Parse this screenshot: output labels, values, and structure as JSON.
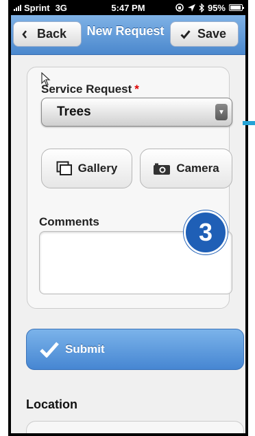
{
  "status_bar": {
    "carrier": "Sprint",
    "network": "3G",
    "time": "5:47 PM",
    "battery": "95%"
  },
  "header": {
    "back_label": "Back",
    "title": "New Request",
    "save_label": "Save"
  },
  "form": {
    "service_label": "Service Request",
    "required_marker": "*",
    "service_value": "Trees",
    "gallery_label": "Gallery",
    "camera_label": "Camera",
    "comments_label": "Comments",
    "comments_value": ""
  },
  "annotation": {
    "step_number": "3"
  },
  "submit_label": "Submit",
  "location_heading": "Location",
  "colors": {
    "header_blue": "#4b88cd",
    "submit_blue": "#4686d2",
    "badge_blue": "#1f5fb6",
    "required_red": "#dd0000",
    "callout_cyan": "#25a3d6"
  },
  "icons": [
    "signal-icon",
    "lock-rotation-icon",
    "location-arrow-icon",
    "bluetooth-icon",
    "battery-icon",
    "chevron-left-icon",
    "checkmark-icon",
    "dropdown-arrow-icon",
    "gallery-icon",
    "camera-icon",
    "pointer-cursor-icon"
  ]
}
